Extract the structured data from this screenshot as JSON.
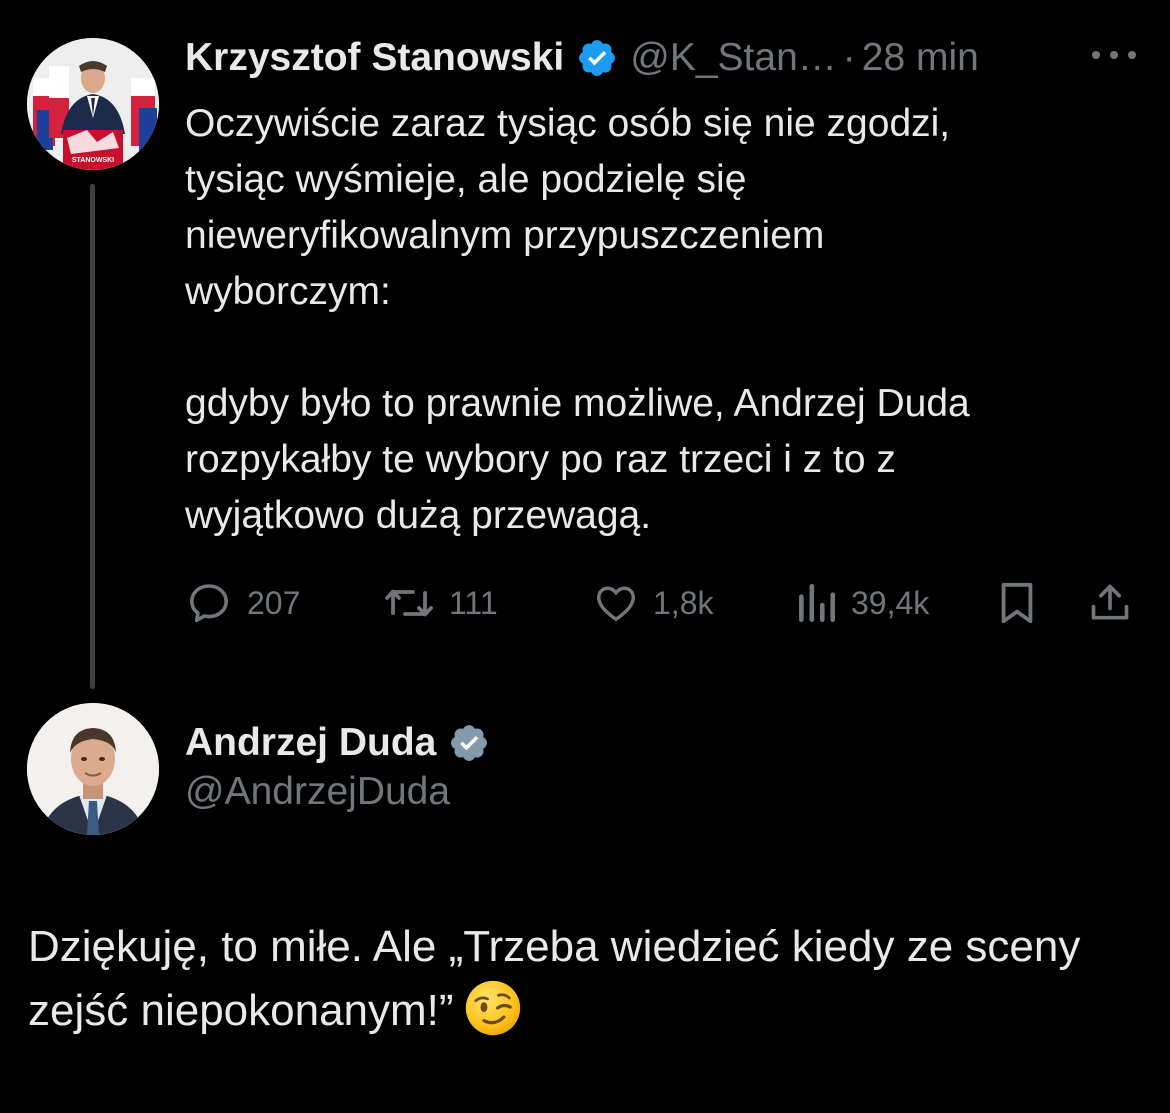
{
  "parent_tweet": {
    "author_name": "Krzysztof Stanowski",
    "handle": "@K_Stan…",
    "separator": "·",
    "time": "28 min",
    "avatar_icon": "avatar-photo-krzysztof-stanowski",
    "avatar_lettering": "STANOWSKI",
    "text": "Oczywiście zaraz tysiąc osób się nie zgodzi,\ntysiąc wyśmieje, ale podzielę się\nnieweryfikowalnym przypuszczeniem\nwyborczym:\n\ngdyby było to prawnie możliwe, Andrzej Duda\nrozpykałby te wybory po raz trzeci i z to z\nwyjątkowo dużą przewagą.",
    "actions": {
      "replies": "207",
      "reposts": "111",
      "likes": "1,8k",
      "views": "39,4k"
    }
  },
  "reply_tweet": {
    "author_name": "Andrzej Duda",
    "handle": "@AndrzejDuda",
    "avatar_icon": "avatar-photo-andrzej-duda",
    "text": "Dziękuję, to miłe. Ale „Trzeba wiedzieć kiedy ze sceny zejść niepokonanym!”",
    "emoji": "winking-face"
  },
  "colors": {
    "background": "#000000",
    "text_primary": "#e7e9ea",
    "text_secondary": "#71767b",
    "verified_blue": "#1d9bf0",
    "verified_gray": "#829aab",
    "thread_line": "#3e4144"
  }
}
